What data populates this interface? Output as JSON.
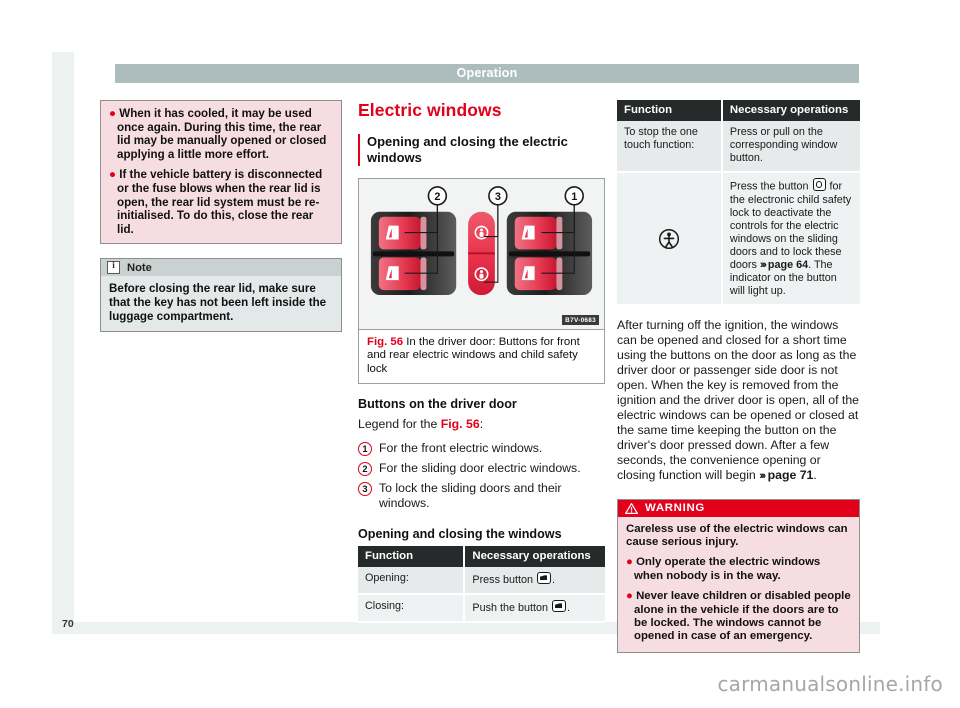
{
  "header": {
    "running_title": "Operation"
  },
  "page_number": "70",
  "watermark": "carmanualsonline.info",
  "left_column": {
    "caution_box": {
      "bullets": [
        "When it has cooled, it may be used once again. During this time, the rear lid may be manually opened or closed applying a little more effort.",
        "If the vehicle battery is disconnected or the fuse blows when the rear lid is open, the rear lid system must be re-initialised. To do this, close the rear lid."
      ]
    },
    "note_box": {
      "icon": "info-icon",
      "title": "Note",
      "text": "Before closing the rear lid, make sure that the key has not been left inside the luggage compartment."
    }
  },
  "middle_column": {
    "section_title": "Electric windows",
    "subsection_title": "Opening and closing the electric windows",
    "figure": {
      "id_label": "B7V-0683",
      "callouts": [
        "2",
        "3",
        "1"
      ],
      "caption_number": "Fig. 56",
      "caption_text": "In the driver door: Buttons for front and rear electric windows and child safety lock"
    },
    "legend_heading": "Buttons on the driver door",
    "legend_intro_prefix": "Legend for the ",
    "legend_intro_ref": "Fig. 56",
    "legend_intro_suffix": ":",
    "legend_items": [
      {
        "num": "1",
        "text": "For the front electric windows."
      },
      {
        "num": "2",
        "text": "For the sliding door electric windows."
      },
      {
        "num": "3",
        "text": "To lock the sliding doors and their windows."
      }
    ],
    "table_heading": "Opening and closing the windows",
    "table": {
      "columns": [
        "Function",
        "Necessary operations"
      ],
      "rows": [
        {
          "function": "Opening:",
          "operation_prefix": "Press button ",
          "operation_icon": "window-button-icon",
          "operation_suffix": "."
        },
        {
          "function": "Closing:",
          "operation_prefix": "Push the button ",
          "operation_icon": "window-button-icon",
          "operation_suffix": "."
        }
      ]
    }
  },
  "right_column": {
    "table": {
      "columns": [
        "Function",
        "Necessary operations"
      ],
      "rows": [
        {
          "function": "To stop the one touch function:",
          "icon": "",
          "operation": "Press or pull on the corresponding window button."
        },
        {
          "function": "",
          "icon": "child-safety-icon",
          "operation_part1": "Press the button ",
          "operation_icon": "child-safety-button-icon",
          "operation_part2": " for the electronic child safety lock to deactivate the controls for the electric windows on the sliding doors and to lock these doors ",
          "operation_ref_arrow": "›››",
          "operation_ref_page": " page 64",
          "operation_part3": ". The indicator on the button will light up."
        }
      ]
    },
    "paragraph_part1": "After turning off the ignition, the windows can be opened and closed for a short time using the buttons on the door as long as the driver door or passenger side door is not open. When the key is removed from the ignition and the driver door is open, all of the electric windows can be opened or closed at the same time keeping the button on the driver's door pressed down. After a few seconds, the convenience opening or closing function will begin ",
    "paragraph_ref_arrow": "›››",
    "paragraph_ref_page": " page 71",
    "paragraph_part2": ".",
    "warning_box": {
      "icon": "warning-triangle-icon",
      "title": "WARNING",
      "lead": "Careless use of the electric windows can cause serious injury.",
      "bullets": [
        "Only operate the electric windows when nobody is in the way.",
        "Never leave children or disabled people alone in the vehicle if the doors are to be locked. The windows cannot be opened in case of an emergency."
      ]
    }
  },
  "colors": {
    "brand_red": "#e2001a",
    "header_band": "#adbdbd",
    "table_header": "#262a2b",
    "caution_bg": "#f6dde2",
    "note_bg": "#e3e8e8"
  }
}
